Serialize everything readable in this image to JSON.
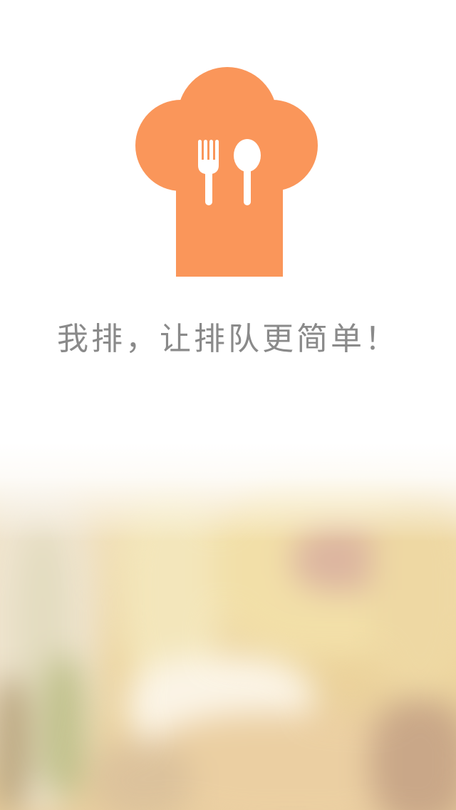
{
  "app": {
    "tagline": "我排，让排队更简单！"
  },
  "logo": {
    "icon": "chef-hat-fork-spoon-icon",
    "color": "#FA965A"
  },
  "background": {
    "description_icon": "restaurant-photo"
  },
  "colors": {
    "accent": "#FA965A",
    "tagline_text": "#8a8a8a",
    "background": "#ffffff"
  }
}
